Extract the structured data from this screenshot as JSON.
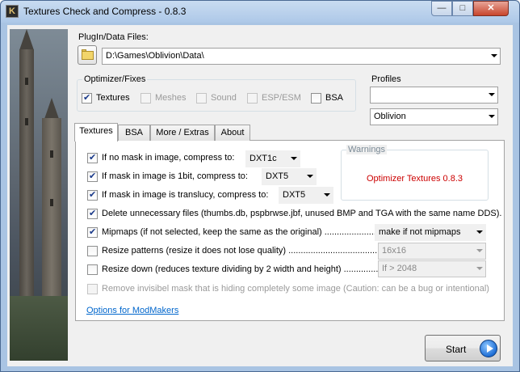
{
  "window": {
    "title": "Textures Check and Compress - 0.8.3",
    "min_glyph": "—",
    "max_glyph": "□",
    "close_glyph": "✕"
  },
  "plugin": {
    "label": "PlugIn/Data Files:",
    "path": "D:\\Games\\Oblivion\\Data\\"
  },
  "optimizer": {
    "title": "Optimizer/Fixes",
    "items": [
      {
        "label": "Textures",
        "checked": true,
        "enabled": true
      },
      {
        "label": "Meshes",
        "checked": false,
        "enabled": false
      },
      {
        "label": "Sound",
        "checked": false,
        "enabled": false
      },
      {
        "label": "ESP/ESM",
        "checked": false,
        "enabled": false
      },
      {
        "label": "BSA",
        "checked": false,
        "enabled": true
      }
    ]
  },
  "profiles": {
    "title": "Profiles",
    "top_value": "",
    "selected": "Oblivion"
  },
  "tabs": [
    "Textures",
    "BSA",
    "More / Extras",
    "About"
  ],
  "active_tab": "Textures",
  "textures": {
    "rows": [
      {
        "label": "If no mask in image, compress to:",
        "checked": true,
        "value": "DXT1c"
      },
      {
        "label": "If mask in image is 1bit, compress to:",
        "checked": true,
        "value": "DXT5"
      },
      {
        "label": "If mask in image is translucy, compress to:",
        "checked": true,
        "value": "DXT5"
      }
    ],
    "delete_unnecessary": {
      "label": "Delete unnecessary files (thumbs.db, pspbrwse.jbf, unused BMP and TGA with the same name DDS).",
      "checked": true
    },
    "mipmaps": {
      "label": "Mipmaps (if not selected, keep the same as the original) ........................",
      "checked": true,
      "value": "make if not mipmaps"
    },
    "resize_patterns": {
      "label": "Resize patterns (resize it does not lose quality) ...........................................",
      "checked": false,
      "value": "16x16"
    },
    "resize_down": {
      "label": "Resize down (reduces texture dividing by 2 width and height) ..................",
      "checked": false,
      "value": "If > 2048"
    },
    "remove_mask": {
      "label": "Remove invisibel mask that is hiding completely some image (Caution: can be a bug or intentional)",
      "checked": false
    },
    "link": "Options for ModMakers"
  },
  "warnings": {
    "title": "Warnings",
    "message": "Optimizer Textures 0.8.3",
    "message_color": "#cc0000"
  },
  "start_button": {
    "label": "Start",
    "icon": "play-icon"
  }
}
